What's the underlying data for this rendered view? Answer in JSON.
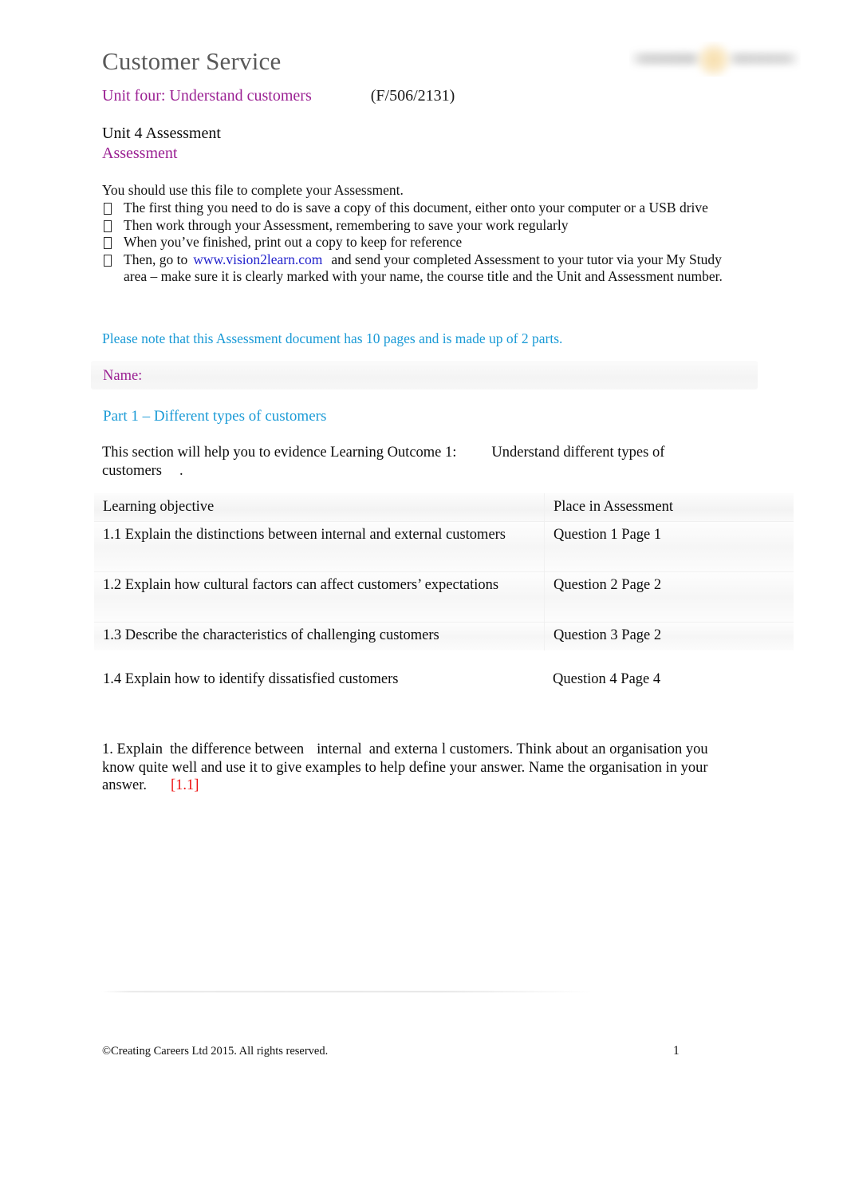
{
  "header": {
    "doc_title": "Customer Service",
    "unit_title": "Unit four: Understand customers",
    "unit_code": "(F/506/2131)",
    "assessment_line_1": "Unit 4 Assessment",
    "assessment_line_2": "Assessment",
    "logo_name": "vision2learn-logo"
  },
  "intro": {
    "lead": "You should use this file to complete your Assessment.",
    "bullets": [
      "The first thing you need to do is save a copy of this document, either onto your computer or a USB drive",
      "Then work through your Assessment, remembering to save your work regularly",
      "When you’ve finished, print out a copy to keep for reference"
    ],
    "bullet_last_pre": "Then, go to",
    "bullet_last_link": "www.vision2learn.com",
    "bullet_last_post": "and send your completed Assessment to your tutor via your My Study area – make sure it is clearly marked with your name, the course title and the Unit and Assessment number.",
    "note": "Please note that this Assessment document has 10 pages and is made up of 2 parts."
  },
  "name_field": {
    "label": "Name:",
    "value": ""
  },
  "part": {
    "heading": "Part 1 – Different types of customers",
    "intro_a": "This section will help you to evidence Learning Outcome 1:",
    "intro_b": "Understand different types of",
    "intro_c": "customers",
    "intro_d": "."
  },
  "lo_table": {
    "columns": [
      "Learning objective",
      "Place in Assessment"
    ],
    "rows": [
      {
        "objective": "1.1 Explain the distinctions between internal and external customers",
        "place": "Question 1 Page 1"
      },
      {
        "objective": "1.2 Explain how cultural factors can affect customers’ expectations",
        "place": "Question 2 Page 2"
      },
      {
        "objective": "1.3 Describe the characteristics of challenging customers",
        "place": "Question 3 Page 2"
      }
    ],
    "extra_row": {
      "objective": "1.4 Explain how to identify dissatisfied customers",
      "place": "Question 4 Page 4"
    }
  },
  "question_1": {
    "part_a": "1. Explain",
    "part_b": "the difference between",
    "part_c": "internal",
    "part_d": "and",
    "part_e": "externa",
    "part_f": "l customers. Think about an organisation you know quite well and use it to give examples to help define your answer. Name the organisation in your answer.",
    "ref": "[1.1]"
  },
  "footer": {
    "copyright": "©Creating Careers Ltd 2015. All rights reserved.",
    "page_number": "1"
  },
  "colors": {
    "purple": "#9B2193",
    "cyan": "#1A9AD6",
    "link_blue": "#2222CC",
    "red": "#EE1111",
    "title_gray": "#595959"
  }
}
